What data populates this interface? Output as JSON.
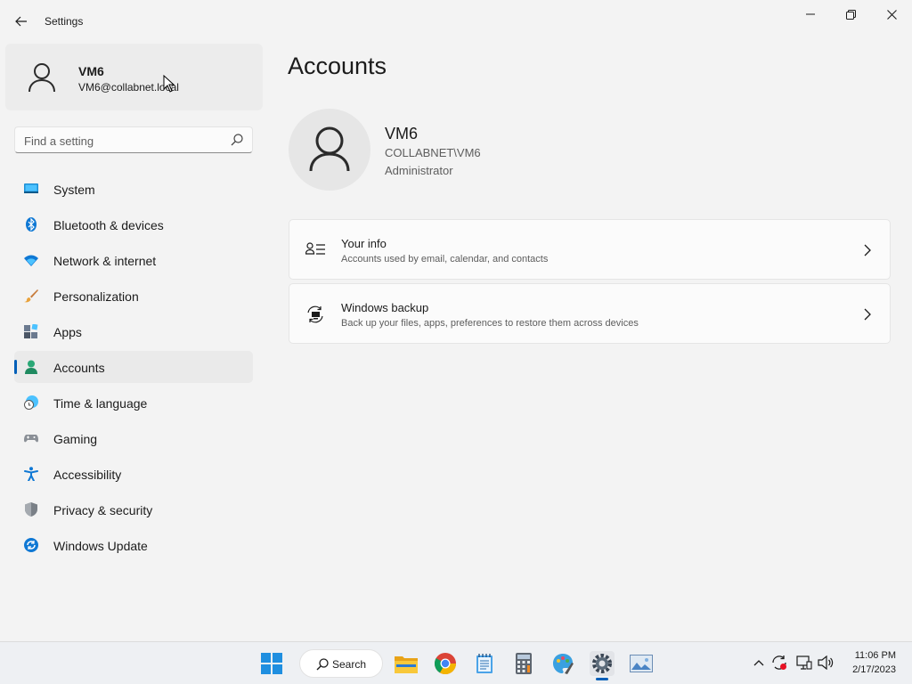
{
  "window": {
    "title": "Settings"
  },
  "profile": {
    "name": "VM6",
    "email": "VM6@collabnet.local"
  },
  "search": {
    "placeholder": "Find a setting"
  },
  "nav": [
    {
      "label": "System",
      "icon": "display-icon",
      "active": false
    },
    {
      "label": "Bluetooth & devices",
      "icon": "bluetooth-icon",
      "active": false
    },
    {
      "label": "Network & internet",
      "icon": "wifi-icon",
      "active": false
    },
    {
      "label": "Personalization",
      "icon": "brush-icon",
      "active": false
    },
    {
      "label": "Apps",
      "icon": "apps-icon",
      "active": false
    },
    {
      "label": "Accounts",
      "icon": "person-icon",
      "active": true
    },
    {
      "label": "Time & language",
      "icon": "globe-clock-icon",
      "active": false
    },
    {
      "label": "Gaming",
      "icon": "gamepad-icon",
      "active": false
    },
    {
      "label": "Accessibility",
      "icon": "accessibility-icon",
      "active": false
    },
    {
      "label": "Privacy & security",
      "icon": "shield-icon",
      "active": false
    },
    {
      "label": "Windows Update",
      "icon": "update-icon",
      "active": false
    }
  ],
  "main": {
    "title": "Accounts",
    "user": {
      "name": "VM6",
      "domain": "COLLABNET\\VM6",
      "role": "Administrator"
    },
    "cards": [
      {
        "title": "Your info",
        "subtitle": "Accounts used by email, calendar, and contacts",
        "icon": "contact-card-icon"
      },
      {
        "title": "Windows backup",
        "subtitle": "Back up your files, apps, preferences to restore them across devices",
        "icon": "backup-icon"
      }
    ]
  },
  "taskbar": {
    "search_label": "Search",
    "apps": [
      "start-icon",
      "file-explorer-icon",
      "chrome-icon",
      "notepad-icon",
      "calculator-icon",
      "paint-icon",
      "settings-icon",
      "photos-icon"
    ],
    "time": "11:06 PM",
    "date": "2/17/2023"
  },
  "colors": {
    "accent": "#005fb8",
    "background": "#f3f3f3",
    "card": "#fbfbfb"
  }
}
